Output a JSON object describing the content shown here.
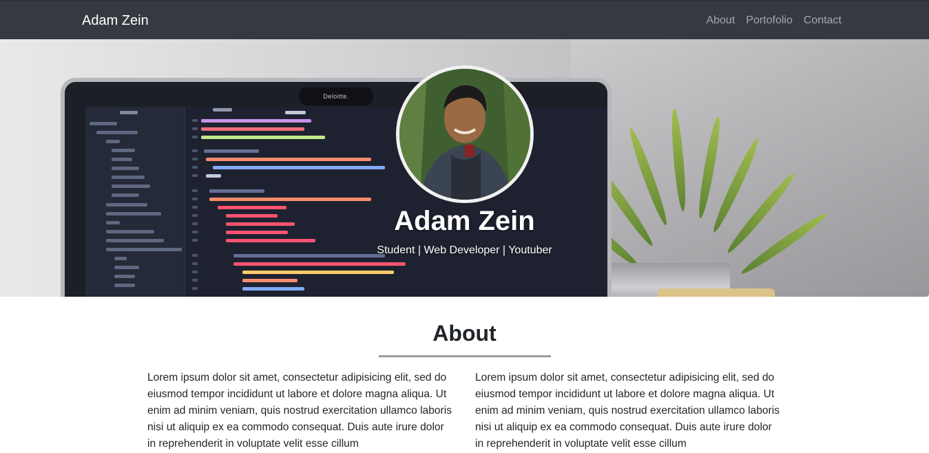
{
  "navbar": {
    "brand": "Adam Zein",
    "links": [
      "About",
      "Portofolio",
      "Contact"
    ]
  },
  "hero": {
    "name": "Adam Zein",
    "subtitle": "Student | Web Developer | Youtuber",
    "laptop_camera_label": "Deloitte."
  },
  "about": {
    "title": "About",
    "paragraphs": [
      "Lorem ipsum dolor sit amet, consectetur adipisicing elit, sed do eiusmod tempor incididunt ut labore et dolore magna aliqua. Ut enim ad minim veniam, quis nostrud exercitation ullamco laboris nisi ut aliquip ex ea commodo consequat. Duis aute irure dolor in reprehenderit in voluptate velit esse cillum",
      "Lorem ipsum dolor sit amet, consectetur adipisicing elit, sed do eiusmod tempor incididunt ut labore et dolore magna aliqua. Ut enim ad minim veniam, quis nostrud exercitation ullamco laboris nisi ut aliquip ex ea commodo consequat. Duis aute irure dolor in reprehenderit in voluptate velit esse cillum"
    ]
  },
  "colors": {
    "navbar_bg": "#343a40",
    "nav_link": "rgba(255,255,255,0.55)",
    "rule": "#9a9a9a"
  }
}
